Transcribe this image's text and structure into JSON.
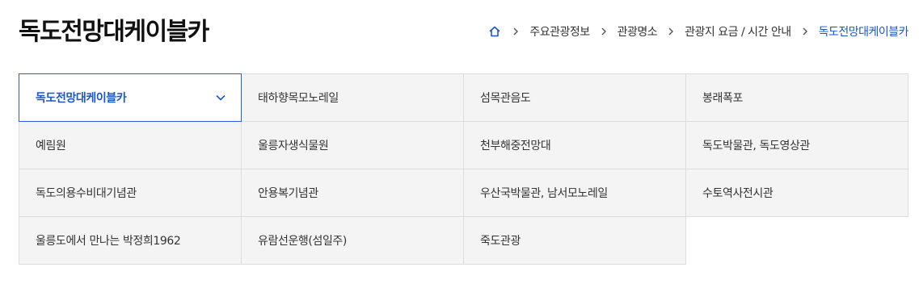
{
  "page_title": "독도전망대케이블카",
  "breadcrumb": {
    "home_icon": "home-icon",
    "items": [
      "주요관광정보",
      "관광명소",
      "관광지 요금 / 시간 안내",
      "독도전망대케이블카"
    ]
  },
  "tabs": [
    {
      "label": "독도전망대케이블카",
      "active": true
    },
    {
      "label": "태하향목모노레일"
    },
    {
      "label": "섬목관음도"
    },
    {
      "label": "봉래폭포"
    },
    {
      "label": "예림원"
    },
    {
      "label": "울릉자생식물원"
    },
    {
      "label": "천부해중전망대"
    },
    {
      "label": "독도박물관, 독도영상관"
    },
    {
      "label": "독도의용수비대기념관"
    },
    {
      "label": "안용복기념관"
    },
    {
      "label": "우산국박물관, 남서모노레일"
    },
    {
      "label": "수토역사전시관"
    },
    {
      "label": "울릉도에서 만나는 박정희1962"
    },
    {
      "label": "유람선운행(섬일주)"
    },
    {
      "label": "죽도관광"
    }
  ],
  "colors": {
    "accent": "#1a56c8",
    "active_border": "#2b5bd7",
    "cell_bg": "#f4f4f4",
    "cell_border": "#dcdcdc"
  }
}
